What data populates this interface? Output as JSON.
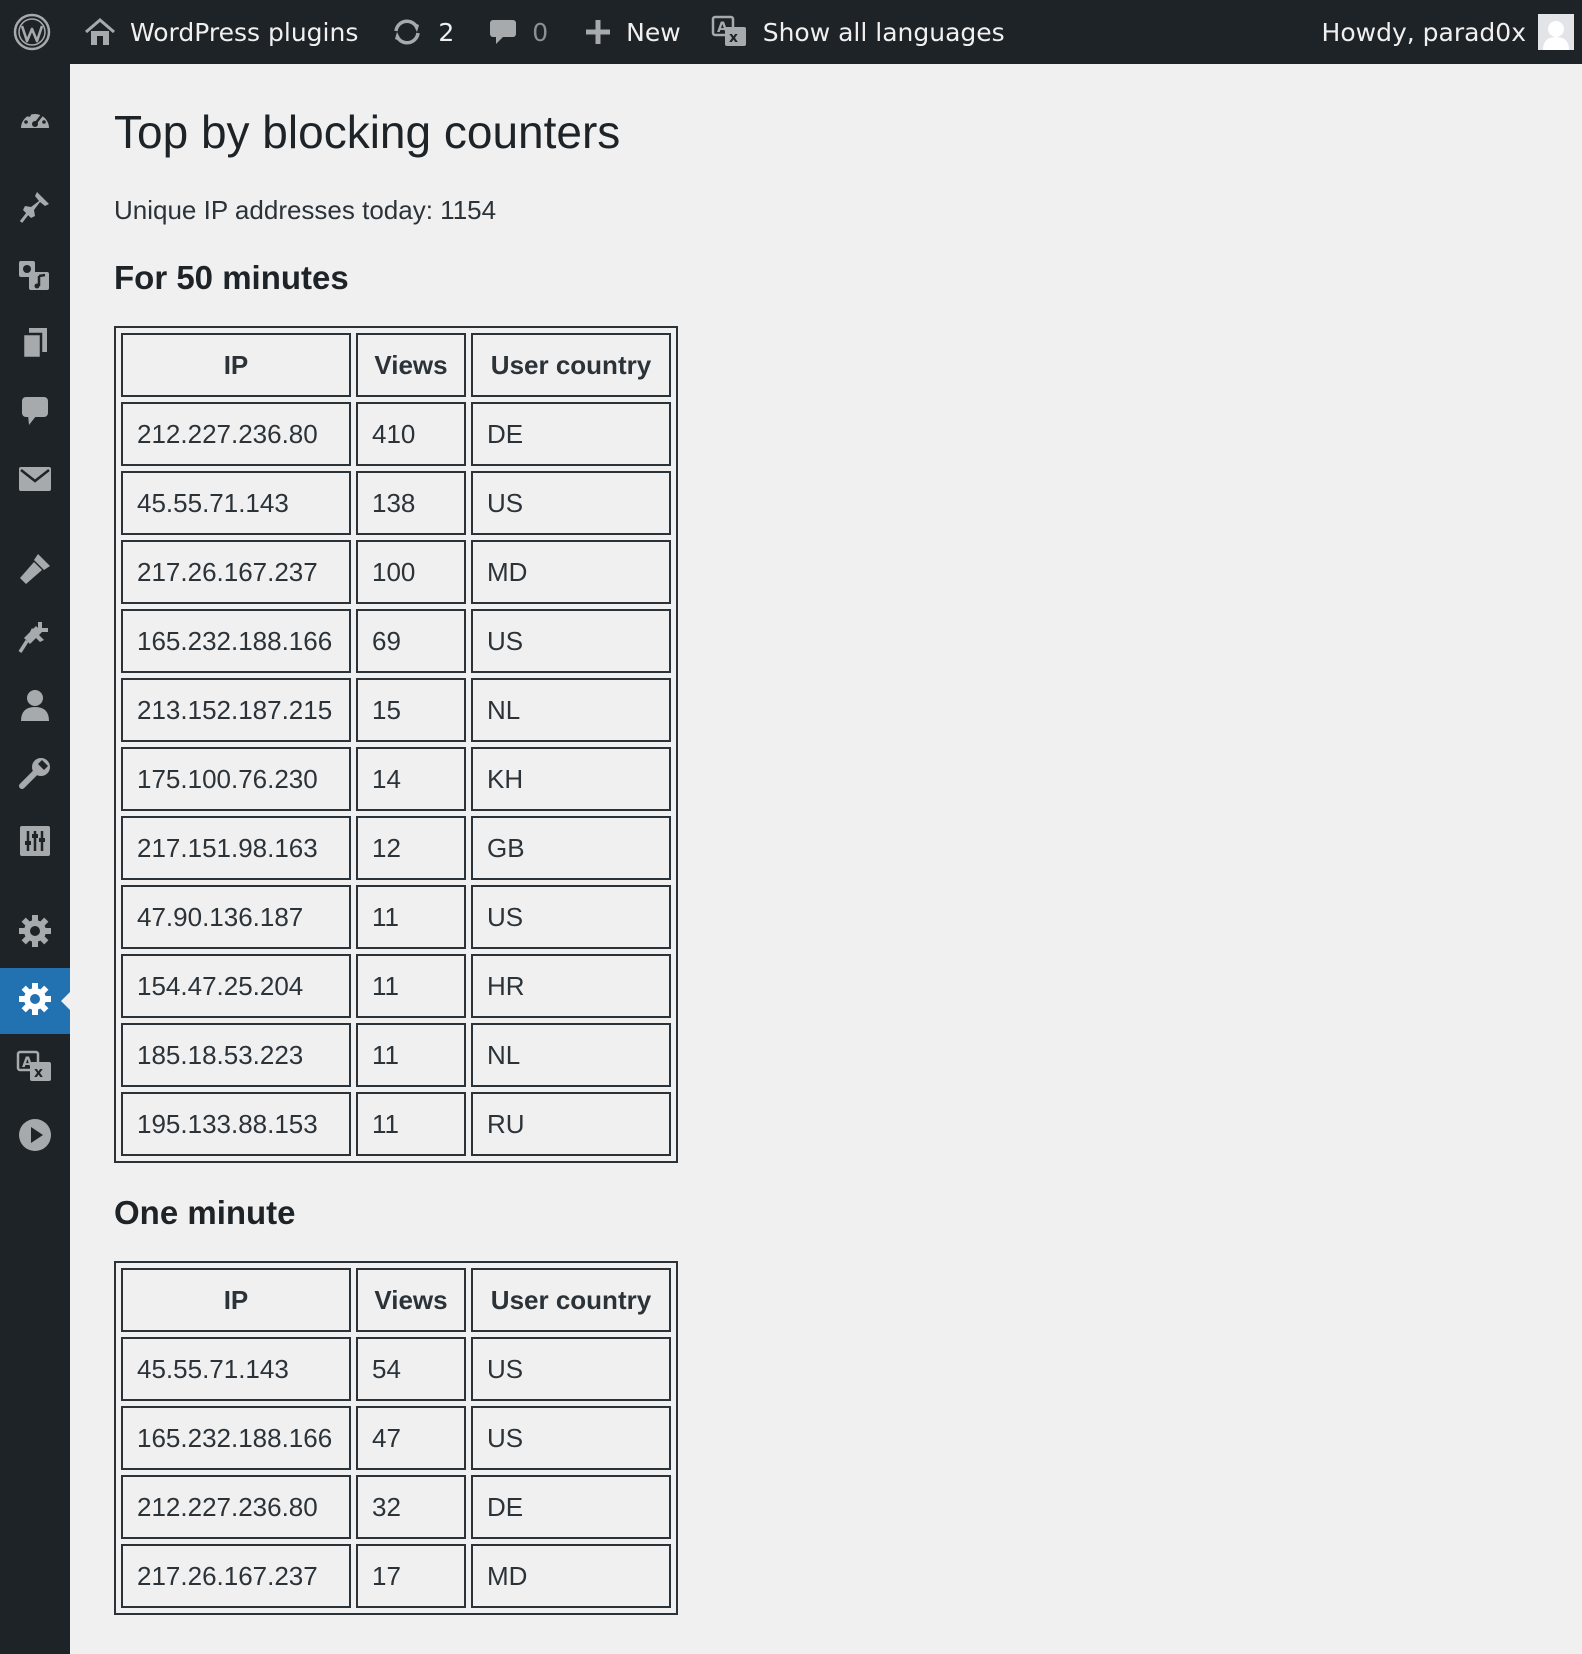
{
  "adminbar": {
    "site_name": "WordPress plugins",
    "updates_count": "2",
    "comments_count": "0",
    "new_label": "New",
    "languages_label": "Show all languages",
    "account_greeting": "Howdy, parad0x"
  },
  "sidebar": {
    "items": [
      {
        "icon": "dashboard-icon"
      },
      {
        "icon": "posts-pin-icon"
      },
      {
        "icon": "media-icon"
      },
      {
        "icon": "pages-icon"
      },
      {
        "icon": "comments-icon"
      },
      {
        "icon": "mail-icon"
      },
      {
        "icon": "appearance-icon"
      },
      {
        "icon": "plugins-icon"
      },
      {
        "icon": "users-icon"
      },
      {
        "icon": "tools-icon"
      },
      {
        "icon": "sliders-icon"
      },
      {
        "icon": "settings-icon"
      },
      {
        "icon": "settings-icon",
        "current": true
      },
      {
        "icon": "translate-icon"
      },
      {
        "icon": "play-icon"
      }
    ]
  },
  "page": {
    "title": "Top by blocking counters",
    "unique_ips": "Unique IP addresses today: 1154"
  },
  "columns": {
    "ip": "IP",
    "views": "Views",
    "country": "User country"
  },
  "sections": [
    {
      "heading": "For 50 minutes",
      "rows": [
        {
          "ip": "212.227.236.80",
          "views": "410",
          "country": "DE"
        },
        {
          "ip": "45.55.71.143",
          "views": "138",
          "country": "US"
        },
        {
          "ip": "217.26.167.237",
          "views": "100",
          "country": "MD"
        },
        {
          "ip": "165.232.188.166",
          "views": "69",
          "country": "US"
        },
        {
          "ip": "213.152.187.215",
          "views": "15",
          "country": "NL"
        },
        {
          "ip": "175.100.76.230",
          "views": "14",
          "country": "KH"
        },
        {
          "ip": "217.151.98.163",
          "views": "12",
          "country": "GB"
        },
        {
          "ip": "47.90.136.187",
          "views": "11",
          "country": "US"
        },
        {
          "ip": "154.47.25.204",
          "views": "11",
          "country": "HR"
        },
        {
          "ip": "185.18.53.223",
          "views": "11",
          "country": "NL"
        },
        {
          "ip": "195.133.88.153",
          "views": "11",
          "country": "RU"
        }
      ]
    },
    {
      "heading": "One minute",
      "rows": [
        {
          "ip": "45.55.71.143",
          "views": "54",
          "country": "US"
        },
        {
          "ip": "165.232.188.166",
          "views": "47",
          "country": "US"
        },
        {
          "ip": "212.227.236.80",
          "views": "32",
          "country": "DE"
        },
        {
          "ip": "217.26.167.237",
          "views": "17",
          "country": "MD"
        }
      ]
    }
  ]
}
